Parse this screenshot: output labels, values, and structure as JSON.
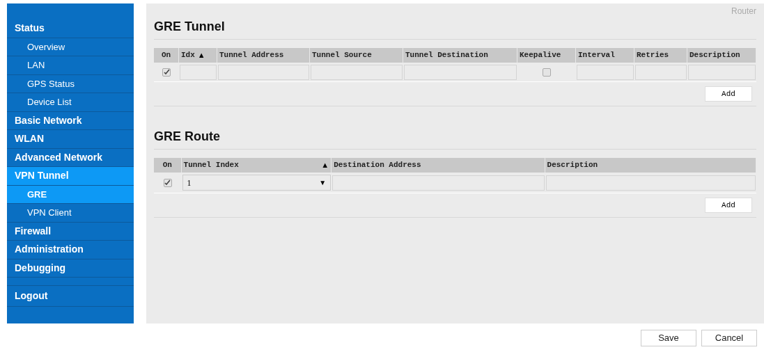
{
  "sidebar": {
    "items": [
      {
        "label": "Status",
        "selected": false,
        "children": [
          {
            "label": "Overview",
            "selected": false
          },
          {
            "label": "LAN",
            "selected": false
          },
          {
            "label": "GPS Status",
            "selected": false
          },
          {
            "label": "Device List",
            "selected": false
          }
        ]
      },
      {
        "label": "Basic Network",
        "selected": false
      },
      {
        "label": "WLAN",
        "selected": false
      },
      {
        "label": "Advanced Network",
        "selected": false
      },
      {
        "label": "VPN Tunnel",
        "selected": true,
        "children": [
          {
            "label": "GRE",
            "selected": true
          },
          {
            "label": "VPN Client",
            "selected": false
          }
        ]
      },
      {
        "label": "Firewall",
        "selected": false
      },
      {
        "label": "Administration",
        "selected": false
      },
      {
        "label": "Debugging",
        "selected": false
      }
    ],
    "logout": "Logout"
  },
  "header": {
    "brand": "Router"
  },
  "gre_tunnel": {
    "title": "GRE Tunnel",
    "columns": [
      {
        "label": "On"
      },
      {
        "label": "Idx",
        "sort_mark": "▲"
      },
      {
        "label": "Tunnel Address"
      },
      {
        "label": "Tunnel Source"
      },
      {
        "label": "Tunnel Destination"
      },
      {
        "label": "Keepalive"
      },
      {
        "label": "Interval"
      },
      {
        "label": "Retries"
      },
      {
        "label": "Description"
      }
    ],
    "rows": [
      {
        "on": true,
        "keepalive": false
      }
    ],
    "add_button": "Add"
  },
  "gre_route": {
    "title": "GRE Route",
    "columns": [
      {
        "label": "On"
      },
      {
        "label": "Tunnel Index",
        "sort_mark": "▲"
      },
      {
        "label": "Destination Address"
      },
      {
        "label": "Description"
      }
    ],
    "rows": [
      {
        "on": true,
        "tunnel_index": "1",
        "dropdown_glyph": "▼"
      }
    ],
    "add_button": "Add"
  },
  "buttons": [
    "Save",
    "Cancel"
  ]
}
